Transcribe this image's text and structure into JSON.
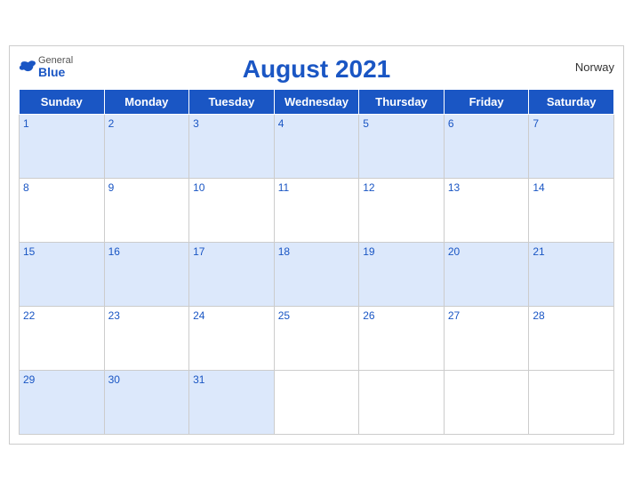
{
  "header": {
    "brand_general": "General",
    "brand_blue": "Blue",
    "month_title": "August 2021",
    "country": "Norway"
  },
  "days_of_week": [
    "Sunday",
    "Monday",
    "Tuesday",
    "Wednesday",
    "Thursday",
    "Friday",
    "Saturday"
  ],
  "weeks": [
    [
      {
        "day": 1,
        "empty": false
      },
      {
        "day": 2,
        "empty": false
      },
      {
        "day": 3,
        "empty": false
      },
      {
        "day": 4,
        "empty": false
      },
      {
        "day": 5,
        "empty": false
      },
      {
        "day": 6,
        "empty": false
      },
      {
        "day": 7,
        "empty": false
      }
    ],
    [
      {
        "day": 8,
        "empty": false
      },
      {
        "day": 9,
        "empty": false
      },
      {
        "day": 10,
        "empty": false
      },
      {
        "day": 11,
        "empty": false
      },
      {
        "day": 12,
        "empty": false
      },
      {
        "day": 13,
        "empty": false
      },
      {
        "day": 14,
        "empty": false
      }
    ],
    [
      {
        "day": 15,
        "empty": false
      },
      {
        "day": 16,
        "empty": false
      },
      {
        "day": 17,
        "empty": false
      },
      {
        "day": 18,
        "empty": false
      },
      {
        "day": 19,
        "empty": false
      },
      {
        "day": 20,
        "empty": false
      },
      {
        "day": 21,
        "empty": false
      }
    ],
    [
      {
        "day": 22,
        "empty": false
      },
      {
        "day": 23,
        "empty": false
      },
      {
        "day": 24,
        "empty": false
      },
      {
        "day": 25,
        "empty": false
      },
      {
        "day": 26,
        "empty": false
      },
      {
        "day": 27,
        "empty": false
      },
      {
        "day": 28,
        "empty": false
      }
    ],
    [
      {
        "day": 29,
        "empty": false
      },
      {
        "day": 30,
        "empty": false
      },
      {
        "day": 31,
        "empty": false
      },
      {
        "day": null,
        "empty": true
      },
      {
        "day": null,
        "empty": true
      },
      {
        "day": null,
        "empty": true
      },
      {
        "day": null,
        "empty": true
      }
    ]
  ]
}
